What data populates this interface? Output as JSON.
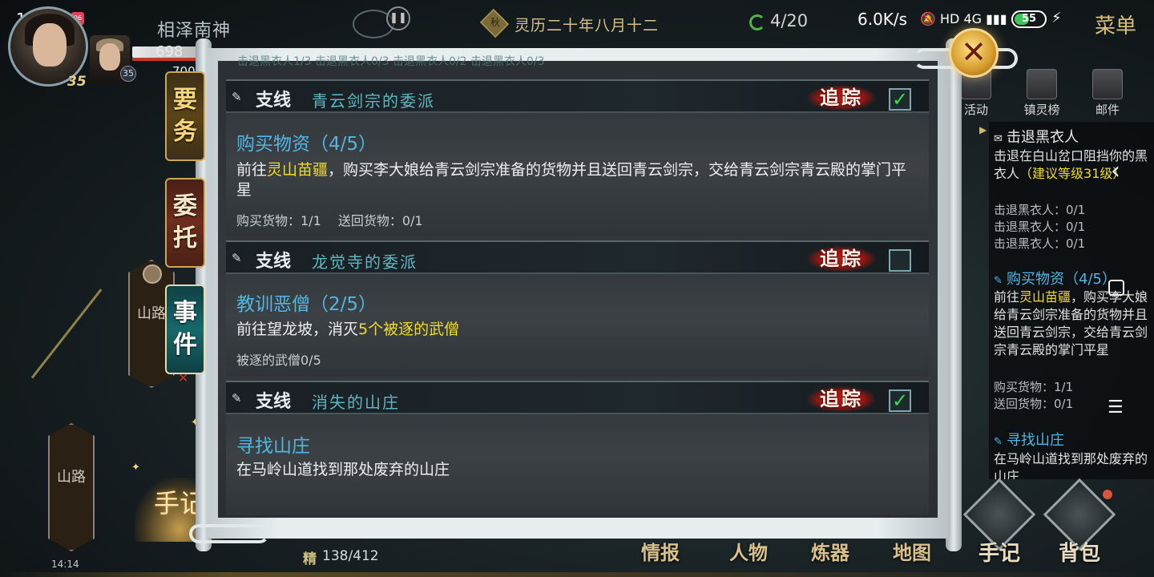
{
  "status_bar": {
    "time": "14:15",
    "notification_badge": "06",
    "net_speed": "6.0K/s",
    "icons": "🔕 HD 4G ▮▮▮",
    "battery": "55",
    "battery_percent": 55,
    "charging": "⚡"
  },
  "hud": {
    "area_name": "相泽南神",
    "player_level": "35",
    "companion_level": "35",
    "hp_value": "698",
    "mp_value": "700",
    "date": "灵历二十年八月十二",
    "date_seal": "秋",
    "counter": "4/20",
    "menu_label": "菜单",
    "pause_icon": "pause-icon",
    "close_icon": "close-icon"
  },
  "top_buttons": [
    {
      "label": "活动",
      "icon": "activity-icon"
    },
    {
      "label": "镇灵榜",
      "icon": "ranking-icon"
    },
    {
      "label": "邮件",
      "icon": "mail-icon"
    }
  ],
  "left_tabs": {
    "main": "要务",
    "commission": "委托",
    "event": "事件"
  },
  "map": {
    "marker_1": "山路",
    "marker_2": "山路",
    "journal_button": "手记",
    "small_clock": "14:14",
    "stamina_label": "精",
    "stamina_value": "138/412"
  },
  "panel": {
    "top_fragment": "击退黑衣人1/3  击退黑衣人0/3  击退黑衣人0/2  击退黑衣人0/3",
    "track_label": "追踪",
    "quests": [
      {
        "type": "支线",
        "name": "青云剑宗的委派",
        "tracked": true,
        "title": "购买物资（4/5）",
        "desc_parts": [
          {
            "text": "前往",
            "hl": false
          },
          {
            "text": "灵山苗疆",
            "hl": true
          },
          {
            "text": "，购买李大娘给青云剑宗准备的货物并且送回青云剑宗，交给青云剑宗青云殿的掌门平星",
            "hl": false
          }
        ],
        "progress": [
          "购买货物：1/1",
          "送回货物：0/1"
        ]
      },
      {
        "type": "支线",
        "name": "龙觉寺的委派",
        "tracked": false,
        "title": "教训恶僧（2/5）",
        "desc_parts": [
          {
            "text": "前往望龙坡，消灭",
            "hl": false
          },
          {
            "text": "5个被逐的武僧",
            "hl": true
          }
        ],
        "progress": [
          "被逐的武僧0/5"
        ]
      },
      {
        "type": "支线",
        "name": "消失的山庄",
        "tracked": true,
        "title": "寻找山庄",
        "desc_parts": [
          {
            "text": "在马岭山道找到那处废弃的山庄",
            "hl": false
          }
        ],
        "progress": []
      }
    ]
  },
  "tracker": {
    "items": [
      {
        "title": "击退黑衣人",
        "desc_a": "击退在白山岔口阻挡你的黑衣人",
        "desc_hl": "（建议等级31级）",
        "subs": [
          "击退黑衣人：0/1",
          "击退黑衣人：0/1",
          "击退黑衣人：0/1"
        ]
      },
      {
        "title": "购买物资（4/5）",
        "desc_a": "前往",
        "desc_hl": "灵山苗疆",
        "desc_b": "，购买李大娘给青云剑宗准备的货物并且送回青云剑宗，交给青云剑宗青云殿的掌门平星",
        "subs": [
          "购买货物：1/1",
          "送回货物：0/1"
        ]
      },
      {
        "title": "寻找山庄",
        "desc_a": "在马岭山道找到那处废弃的山庄"
      }
    ]
  },
  "bottom_nav": [
    "情报",
    "人物",
    "炼器",
    "地图"
  ],
  "bottom_big": [
    {
      "label": "手记",
      "icon": "journal-icon"
    },
    {
      "label": "背包",
      "icon": "backpack-icon"
    }
  ],
  "colors": {
    "quest_blue": "#52b6e2",
    "highlight_yellow": "#f0dc2a",
    "track_red": "#b01d16",
    "check_green": "#36e04a"
  }
}
